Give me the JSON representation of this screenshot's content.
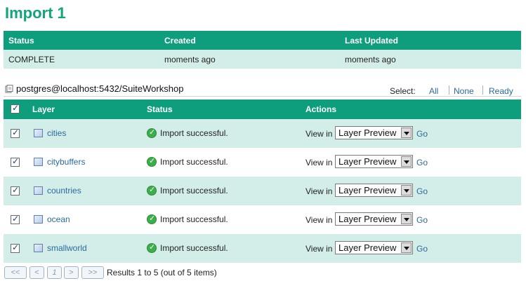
{
  "title": "Import 1",
  "summary": {
    "headers": [
      "Status",
      "Created",
      "Last Updated"
    ],
    "row": [
      "COMPLETE",
      "moments ago",
      "moments ago"
    ]
  },
  "store": {
    "icon": "database-icon",
    "name": "postgres@localhost:5432/SuiteWorkshop"
  },
  "select": {
    "label": "Select:",
    "options": [
      "All",
      "None",
      "Ready"
    ]
  },
  "layers_table": {
    "headers": [
      "Layer",
      "Status",
      "Actions"
    ],
    "rows": [
      {
        "layer": "cities",
        "status": "Import successful.",
        "view_in": "View in",
        "preview": "Layer Preview",
        "go": "Go"
      },
      {
        "layer": "citybuffers",
        "status": "Import successful.",
        "view_in": "View in",
        "preview": "Layer Preview",
        "go": "Go"
      },
      {
        "layer": "countries",
        "status": "Import successful.",
        "view_in": "View in",
        "preview": "Layer Preview",
        "go": "Go"
      },
      {
        "layer": "ocean",
        "status": "Import successful.",
        "view_in": "View in",
        "preview": "Layer Preview",
        "go": "Go"
      },
      {
        "layer": "smallworld",
        "status": "Import successful.",
        "view_in": "View in",
        "preview": "Layer Preview",
        "go": "Go"
      }
    ]
  },
  "pager": {
    "first": "<<",
    "prev": "<",
    "page": "1",
    "next": ">",
    "last": ">>",
    "results": "Results 1 to 5 (out of 5 items)"
  },
  "colors": {
    "accent": "#0e9e7e",
    "title": "#12a57c",
    "row_alt": "#d3eee8",
    "link": "#2a6a9e"
  }
}
